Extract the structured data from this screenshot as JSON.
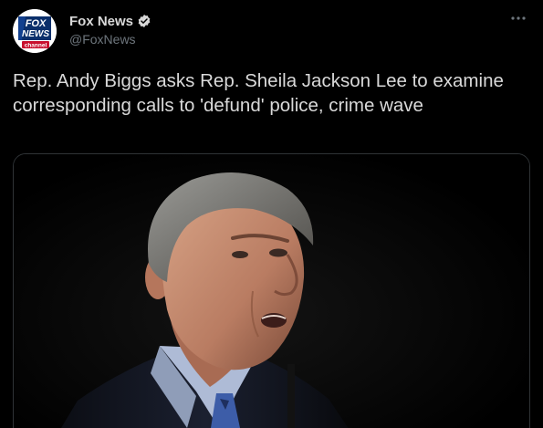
{
  "account": {
    "display_name": "Fox News",
    "handle": "@FoxNews",
    "avatar_icon": "fox-news-channel-logo",
    "avatar_text": {
      "line1": "FOX",
      "line2": "NEWS",
      "line3": "channel"
    },
    "verified": true
  },
  "menu": {
    "icon": "more-horizontal-icon"
  },
  "tweet": {
    "text": "Rep. Andy Biggs asks Rep. Sheila Jackson Lee to examine corresponding calls to 'defund' police, crime wave"
  },
  "media": {
    "description_icon": "man-speaking-at-podium-photo"
  },
  "colors": {
    "background": "#000000",
    "text": "#d9d9d9",
    "secondary_text": "#6e767d",
    "verified_badge": "#d9d9d9",
    "card_border": "#2f3336"
  }
}
